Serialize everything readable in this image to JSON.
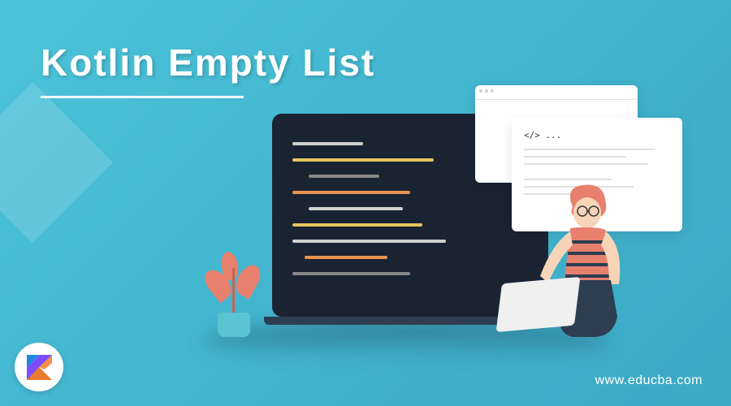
{
  "title": "Kotlin Empty List",
  "watermark": "www.educba.com",
  "code_tag": "</> ...",
  "colors": {
    "bg_primary": "#4BC3D9",
    "bg_secondary": "#3BA8C4",
    "laptop_screen": "#1a2332",
    "accent_orange": "#e8806e",
    "code_yellow": "#e6c55f",
    "code_orange": "#e69350",
    "code_light": "#d0d0d0"
  }
}
